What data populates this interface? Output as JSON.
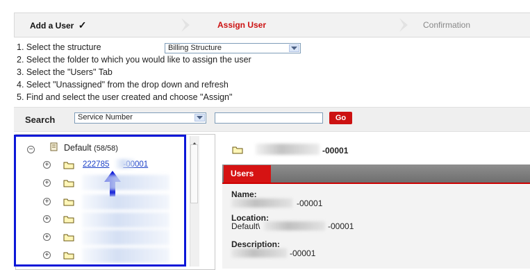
{
  "wizard": {
    "steps": [
      {
        "label": "Add a User",
        "check": "✓",
        "state": "done"
      },
      {
        "label": "Assign User",
        "state": "active"
      },
      {
        "label": "Confirmation",
        "state": "pending"
      }
    ]
  },
  "instructions": [
    "1. Select the structure",
    "2. Select the folder to which you would like to assign the user",
    "3. Select the \"Users\" Tab",
    "4. Select \"Unassigned\" from the drop down and refresh",
    "5. Find and select the user created and choose \"Assign\""
  ],
  "structure_select": {
    "value": "Billing Structure"
  },
  "search": {
    "label": "Search",
    "field_select": "Service Number",
    "input_value": "",
    "go_label": "Go"
  },
  "tree": {
    "root_label": "Default",
    "root_count": "(58/58)",
    "first_child_prefix": "222785",
    "first_child_suffix": "-00001",
    "child_count": 6
  },
  "detail": {
    "folder_suffix": "-00001",
    "tab_label": "Users",
    "name_label": "Name:",
    "name_value": "-00001",
    "location_label": "Location:",
    "location_prefix": "Default\\",
    "location_value": "-00001",
    "description_label": "Description:",
    "description_value": "-00001"
  },
  "colors": {
    "active_step": "#cc1111",
    "highlight_border": "#0b17d8",
    "arrow": "#0b17d8",
    "tab_red": "#d61313",
    "link": "#1a3fc7"
  }
}
